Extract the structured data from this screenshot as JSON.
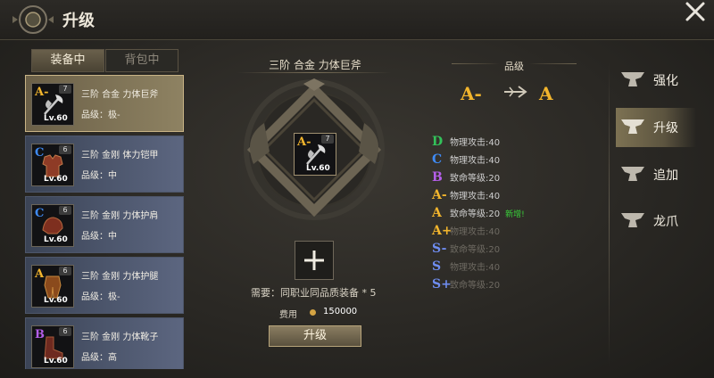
{
  "header": {
    "title": "升级"
  },
  "tabs": {
    "equipped": "装备中",
    "backpack": "背包中"
  },
  "items": [
    {
      "grade": "A-",
      "grade_color": "#f2b52d",
      "count": "7",
      "level": "Lv.60",
      "name": "三阶 合金 力体巨斧",
      "quality": "品级：极-",
      "selected": true
    },
    {
      "grade": "C",
      "grade_color": "#3f8bf5",
      "count": "6",
      "level": "Lv.60",
      "name": "三阶 金刚 体力铠甲",
      "quality": "品级：中"
    },
    {
      "grade": "C",
      "grade_color": "#3f8bf5",
      "count": "6",
      "level": "Lv.60",
      "name": "三阶 金刚 力体护肩",
      "quality": "品级：中"
    },
    {
      "grade": "A",
      "grade_color": "#f2b52d",
      "count": "6",
      "level": "Lv.60",
      "name": "三阶 金刚 力体护腿",
      "quality": "品级：极-"
    },
    {
      "grade": "B",
      "grade_color": "#b45ee8",
      "count": "6",
      "level": "Lv.60",
      "name": "三阶 金刚 力体靴子",
      "quality": "品级：高"
    }
  ],
  "center": {
    "item_name": "三阶 合金 力体巨斧",
    "item_grade": "A-",
    "item_count": "7",
    "item_level": "Lv.60",
    "requirement": "需要：同职业同品质装备 * 5",
    "cost_label": "费用",
    "cost_value": "150000",
    "upgrade_button": "升级"
  },
  "stats_panel": {
    "title": "品级",
    "from_grade": "A-",
    "to_grade": "A",
    "rows": [
      {
        "grade": "D",
        "color": "#33c25a",
        "text": "物理攻击:40",
        "text_color": "#cfcfcf"
      },
      {
        "grade": "C",
        "color": "#3f8bf5",
        "text": "物理攻击:40",
        "text_color": "#cfcfcf"
      },
      {
        "grade": "B",
        "color": "#b45ee8",
        "text": "致命等级:20",
        "text_color": "#cfcfcf"
      },
      {
        "grade": "A-",
        "color": "#f2b52d",
        "text": "物理攻击:40",
        "text_color": "#cfcfcf"
      },
      {
        "grade": "A",
        "color": "#f2b52d",
        "text": "致命等级:20",
        "text_color": "#cfcfcf",
        "badge": "新增!"
      },
      {
        "grade": "A+",
        "color": "#f2b52d",
        "text": "物理攻击:40",
        "text_color": "#6e6a62"
      },
      {
        "grade": "S-",
        "color": "#6f8df0",
        "text": "致命等级:20",
        "text_color": "#6e6a62"
      },
      {
        "grade": "S",
        "color": "#6f8df0",
        "text": "物理攻击:40",
        "text_color": "#6e6a62"
      },
      {
        "grade": "S+",
        "color": "#6f8df0",
        "text": "致命等级:20",
        "text_color": "#6e6a62"
      }
    ]
  },
  "nav": [
    {
      "label": "强化",
      "icon": "anvil-icon"
    },
    {
      "label": "升级",
      "icon": "anvil-icon",
      "active": true
    },
    {
      "label": "追加",
      "icon": "anvil-icon"
    },
    {
      "label": "龙爪",
      "icon": "anvil-icon"
    }
  ]
}
